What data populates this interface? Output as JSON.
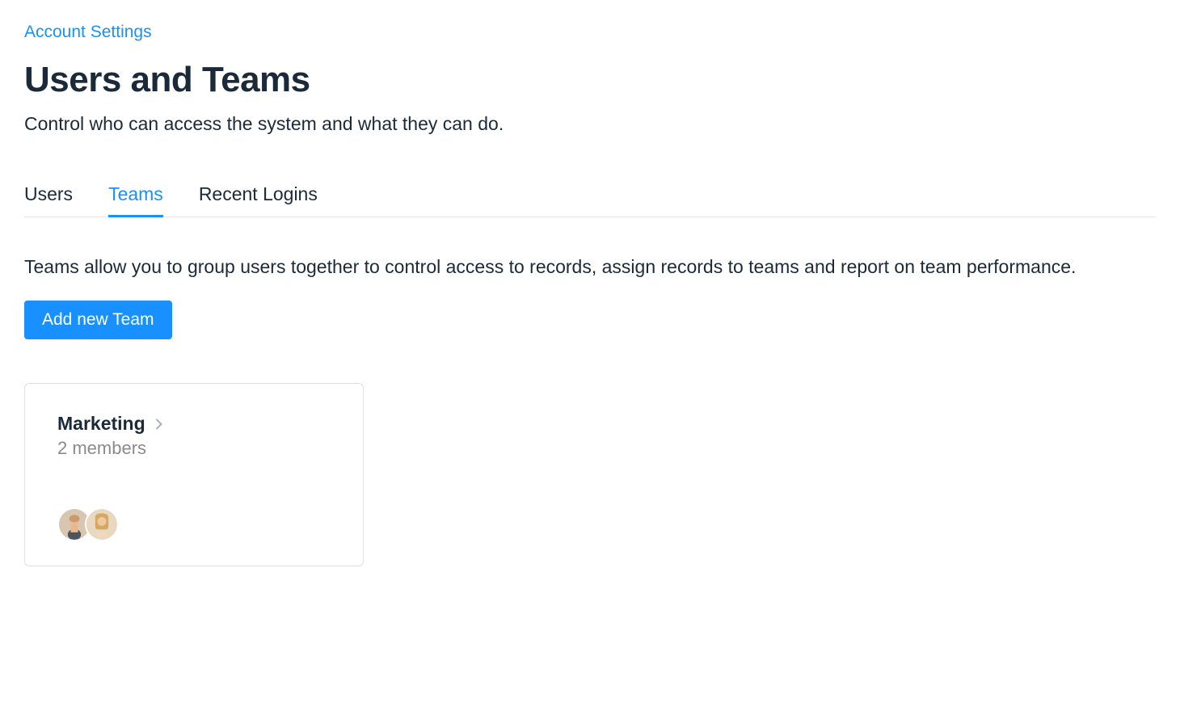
{
  "breadcrumb": "Account Settings",
  "page": {
    "title": "Users and Teams",
    "subtitle": "Control who can access the system and what they can do."
  },
  "tabs": [
    {
      "label": "Users",
      "active": false
    },
    {
      "label": "Teams",
      "active": true
    },
    {
      "label": "Recent Logins",
      "active": false
    }
  ],
  "teamsSection": {
    "description": "Teams allow you to group users together to control access to records, assign records to teams and report on team performance.",
    "addButton": "Add new Team"
  },
  "teams": [
    {
      "name": "Marketing",
      "membersLabel": "2 members",
      "memberCount": 2,
      "avatars": [
        "person-1",
        "person-2"
      ]
    }
  ]
}
